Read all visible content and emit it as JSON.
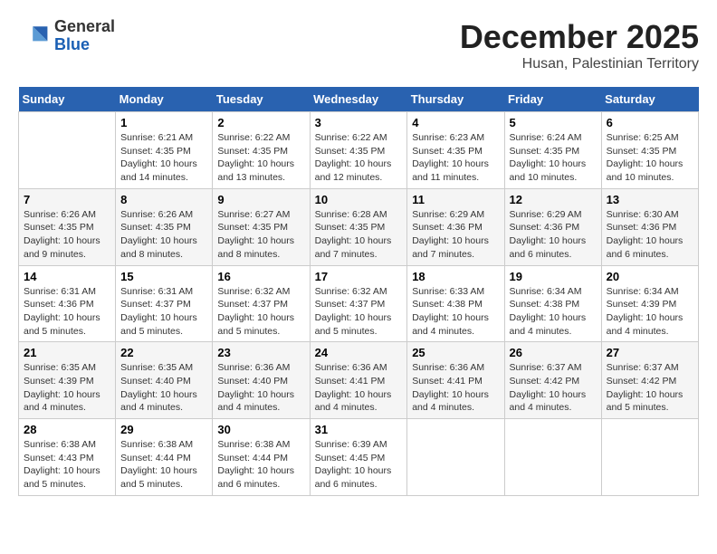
{
  "header": {
    "logo_general": "General",
    "logo_blue": "Blue",
    "month_title": "December 2025",
    "location": "Husan, Palestinian Territory"
  },
  "days_of_week": [
    "Sunday",
    "Monday",
    "Tuesday",
    "Wednesday",
    "Thursday",
    "Friday",
    "Saturday"
  ],
  "weeks": [
    [
      {
        "num": "",
        "info": ""
      },
      {
        "num": "1",
        "info": "Sunrise: 6:21 AM\nSunset: 4:35 PM\nDaylight: 10 hours\nand 14 minutes."
      },
      {
        "num": "2",
        "info": "Sunrise: 6:22 AM\nSunset: 4:35 PM\nDaylight: 10 hours\nand 13 minutes."
      },
      {
        "num": "3",
        "info": "Sunrise: 6:22 AM\nSunset: 4:35 PM\nDaylight: 10 hours\nand 12 minutes."
      },
      {
        "num": "4",
        "info": "Sunrise: 6:23 AM\nSunset: 4:35 PM\nDaylight: 10 hours\nand 11 minutes."
      },
      {
        "num": "5",
        "info": "Sunrise: 6:24 AM\nSunset: 4:35 PM\nDaylight: 10 hours\nand 10 minutes."
      },
      {
        "num": "6",
        "info": "Sunrise: 6:25 AM\nSunset: 4:35 PM\nDaylight: 10 hours\nand 10 minutes."
      }
    ],
    [
      {
        "num": "7",
        "info": "Sunrise: 6:26 AM\nSunset: 4:35 PM\nDaylight: 10 hours\nand 9 minutes."
      },
      {
        "num": "8",
        "info": "Sunrise: 6:26 AM\nSunset: 4:35 PM\nDaylight: 10 hours\nand 8 minutes."
      },
      {
        "num": "9",
        "info": "Sunrise: 6:27 AM\nSunset: 4:35 PM\nDaylight: 10 hours\nand 8 minutes."
      },
      {
        "num": "10",
        "info": "Sunrise: 6:28 AM\nSunset: 4:35 PM\nDaylight: 10 hours\nand 7 minutes."
      },
      {
        "num": "11",
        "info": "Sunrise: 6:29 AM\nSunset: 4:36 PM\nDaylight: 10 hours\nand 7 minutes."
      },
      {
        "num": "12",
        "info": "Sunrise: 6:29 AM\nSunset: 4:36 PM\nDaylight: 10 hours\nand 6 minutes."
      },
      {
        "num": "13",
        "info": "Sunrise: 6:30 AM\nSunset: 4:36 PM\nDaylight: 10 hours\nand 6 minutes."
      }
    ],
    [
      {
        "num": "14",
        "info": "Sunrise: 6:31 AM\nSunset: 4:36 PM\nDaylight: 10 hours\nand 5 minutes."
      },
      {
        "num": "15",
        "info": "Sunrise: 6:31 AM\nSunset: 4:37 PM\nDaylight: 10 hours\nand 5 minutes."
      },
      {
        "num": "16",
        "info": "Sunrise: 6:32 AM\nSunset: 4:37 PM\nDaylight: 10 hours\nand 5 minutes."
      },
      {
        "num": "17",
        "info": "Sunrise: 6:32 AM\nSunset: 4:37 PM\nDaylight: 10 hours\nand 5 minutes."
      },
      {
        "num": "18",
        "info": "Sunrise: 6:33 AM\nSunset: 4:38 PM\nDaylight: 10 hours\nand 4 minutes."
      },
      {
        "num": "19",
        "info": "Sunrise: 6:34 AM\nSunset: 4:38 PM\nDaylight: 10 hours\nand 4 minutes."
      },
      {
        "num": "20",
        "info": "Sunrise: 6:34 AM\nSunset: 4:39 PM\nDaylight: 10 hours\nand 4 minutes."
      }
    ],
    [
      {
        "num": "21",
        "info": "Sunrise: 6:35 AM\nSunset: 4:39 PM\nDaylight: 10 hours\nand 4 minutes."
      },
      {
        "num": "22",
        "info": "Sunrise: 6:35 AM\nSunset: 4:40 PM\nDaylight: 10 hours\nand 4 minutes."
      },
      {
        "num": "23",
        "info": "Sunrise: 6:36 AM\nSunset: 4:40 PM\nDaylight: 10 hours\nand 4 minutes."
      },
      {
        "num": "24",
        "info": "Sunrise: 6:36 AM\nSunset: 4:41 PM\nDaylight: 10 hours\nand 4 minutes."
      },
      {
        "num": "25",
        "info": "Sunrise: 6:36 AM\nSunset: 4:41 PM\nDaylight: 10 hours\nand 4 minutes."
      },
      {
        "num": "26",
        "info": "Sunrise: 6:37 AM\nSunset: 4:42 PM\nDaylight: 10 hours\nand 4 minutes."
      },
      {
        "num": "27",
        "info": "Sunrise: 6:37 AM\nSunset: 4:42 PM\nDaylight: 10 hours\nand 5 minutes."
      }
    ],
    [
      {
        "num": "28",
        "info": "Sunrise: 6:38 AM\nSunset: 4:43 PM\nDaylight: 10 hours\nand 5 minutes."
      },
      {
        "num": "29",
        "info": "Sunrise: 6:38 AM\nSunset: 4:44 PM\nDaylight: 10 hours\nand 5 minutes."
      },
      {
        "num": "30",
        "info": "Sunrise: 6:38 AM\nSunset: 4:44 PM\nDaylight: 10 hours\nand 6 minutes."
      },
      {
        "num": "31",
        "info": "Sunrise: 6:39 AM\nSunset: 4:45 PM\nDaylight: 10 hours\nand 6 minutes."
      },
      {
        "num": "",
        "info": ""
      },
      {
        "num": "",
        "info": ""
      },
      {
        "num": "",
        "info": ""
      }
    ]
  ]
}
